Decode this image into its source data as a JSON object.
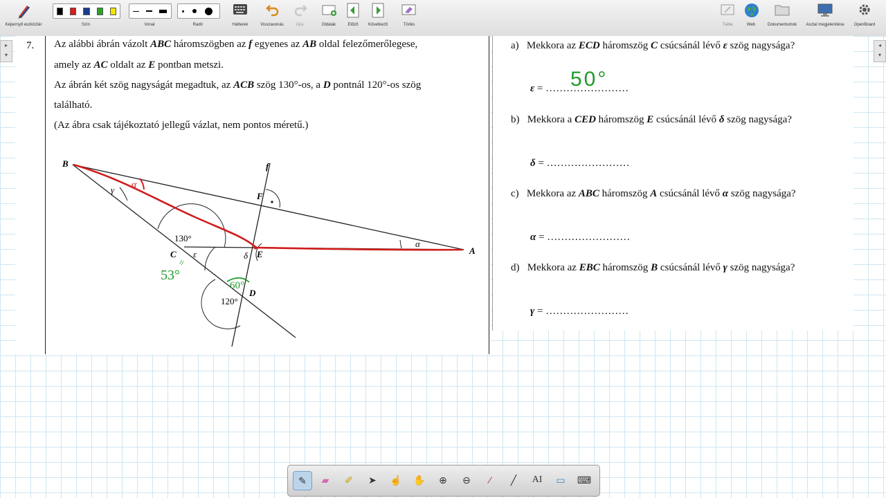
{
  "toolbar": {
    "pen_tools_label": "Képernyő eszköztár",
    "color_label": "Szín",
    "colors": [
      "#000000",
      "#d81b1b",
      "#1a3c8e",
      "#29a329",
      "#f2e600"
    ],
    "line_label": "Vonal",
    "eraser_label": "Radír",
    "backgrounds_label": "Hátterek",
    "undo_label": "Visszavonás",
    "redo_label": "Újra",
    "pages_label": "Oldalak",
    "prev_label": "Előző",
    "next_label": "Következő",
    "clear_label": "Törlés",
    "board_label": "Tábla",
    "web_label": "Web",
    "documents_label": "Dokumentumok",
    "desktop_label": "Asztal megjelenítése",
    "openboard_label": "OpenBoard"
  },
  "problem": {
    "number": "7.",
    "lines": [
      [
        "Az alábbi ábrán vázolt ",
        "ABC",
        " háromszögben az ",
        "f",
        " egyenes az ",
        "AB",
        " oldal felezőmerőlegese,"
      ],
      [
        "amely az ",
        "AC",
        " oldalt az ",
        "E",
        " pontban metszi."
      ],
      [
        "Az ábrán két szög nagyságát megadtuk, az ",
        "ACB",
        " szög 130°-os, a ",
        "D",
        " pontnál 120°-os szög"
      ],
      [
        "található."
      ],
      [
        "(Az ábra csak tájékoztató jellegű vázlat, nem pontos méretű.)"
      ]
    ],
    "figure": {
      "points": {
        "A": "A",
        "B": "B",
        "C": "C",
        "D": "D",
        "E": "E",
        "F": "F",
        "f": "f"
      },
      "angle_labels": {
        "gamma": "γ",
        "epsilon": "ε",
        "delta": "δ",
        "alpha": "α",
        "acb": "130°",
        "d": "120°"
      },
      "handwriting": {
        "alpha_mark": "α",
        "fifty_three": "53°",
        "eq_mark": "=",
        "sixty": "60°"
      }
    }
  },
  "questions": [
    {
      "letter": "a)",
      "text_before": "Mekkora az ",
      "tri": "ECD",
      "text_mid": " háromszög ",
      "vertex": "C",
      "text_after": " csúcsánál lévő ",
      "sym": "ε",
      "text_end": " szög nagysága?",
      "answer_sym": "ε",
      "answer_line": "= ……………………",
      "handwritten": "50°"
    },
    {
      "letter": "b)",
      "text_before": "Mekkora a ",
      "tri": "CED",
      "text_mid": " háromszög ",
      "vertex": "E",
      "text_after": " csúcsánál lévő ",
      "sym": "δ",
      "text_end": " szög nagysága?",
      "answer_sym": "δ",
      "answer_line": "= ……………………"
    },
    {
      "letter": "c)",
      "text_before": "Mekkora az ",
      "tri": "ABC",
      "text_mid": " háromszög ",
      "vertex": "A",
      "text_after": " csúcsánál lévő ",
      "sym": "α",
      "text_end": " szög nagysága?",
      "answer_sym": "α",
      "answer_line": "= ……………………"
    },
    {
      "letter": "d)",
      "text_before": "Mekkora az ",
      "tri": "EBC",
      "text_mid": " háromszög ",
      "vertex": "B",
      "text_after": " csúcsánál lévő ",
      "sym": "γ",
      "text_end": " szög nagysága?",
      "answer_sym": "γ",
      "answer_line": "= ……………………"
    }
  ],
  "bottom_tools": [
    "pen-icon",
    "eraser-icon",
    "highlighter-icon",
    "pointer-icon",
    "interact-icon",
    "hand-icon",
    "zoom-in-icon",
    "zoom-out-icon",
    "laser-icon",
    "line-icon",
    "text-icon",
    "capture-icon",
    "keyboard-icon"
  ],
  "bottom_tools_glyphs": [
    "✎",
    "▰",
    "✐",
    "➤",
    "☝",
    "✋",
    "⊕",
    "⊖",
    "⁄",
    "╱",
    "AI",
    "▭",
    "⌨"
  ]
}
